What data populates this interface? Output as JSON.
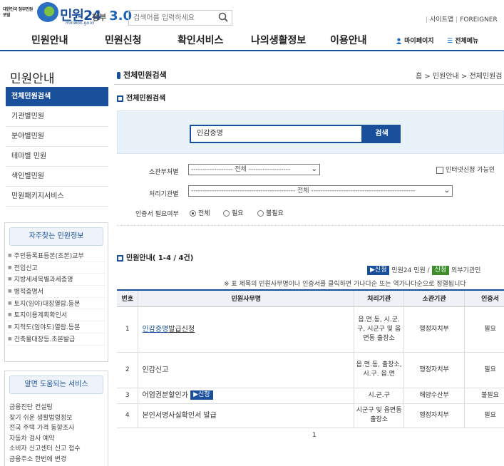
{
  "header": {
    "gov_logo_text": "대한민국 정부민원포털",
    "logo_name": "민원24",
    "logo_url": "minwon.go.kr",
    "gov30_prefix": "정부",
    "gov30_num": "3.0",
    "search_placeholder": "검색어를 입력하세요",
    "sitemap": "사이트맵",
    "foreigner": "FOREIGNER"
  },
  "gnb": {
    "items": [
      "민원안내",
      "민원신청",
      "확인서비스",
      "나의생활정보",
      "이용안내"
    ],
    "mypage": "마이페이지",
    "allmenu": "전체메뉴"
  },
  "sidebar": {
    "title": "민원안내",
    "items": [
      "전체민원검색",
      "기관별민원",
      "분야별민원",
      "테마별 민원",
      "색인별민원",
      "민원패키지서비스"
    ],
    "faq_title": "자주찾는 민원정보",
    "faq_items": [
      "주민등록표등본(초본)교부",
      "전입신고",
      "지방세세목별과세증명",
      "병적증명서",
      "토지(임야)대장열람.등본",
      "토지이용계획확인서",
      "지적도(임야도)열람.등본",
      "건축물대장등.초본발급"
    ],
    "help_title": "알면 도움되는 서비스",
    "help_items": [
      "금융진단 컨설팅",
      "찾기 쉬운 생활법령정보",
      "전국 주택 가격 동향조사",
      "자동차 검사 예약",
      "소비자 신고센터 신고 접수",
      "금융주소 한번에 변경"
    ]
  },
  "main": {
    "page_title": "전체민원검색",
    "breadcrumb": "홈 > 민원안내 > 전체민원검",
    "sub_title": "전체민원검색",
    "search_value": "인감증명",
    "search_button": "검색",
    "dept_label": "소관부처별",
    "dept_value": "------------------ 전체 ------------------",
    "org_label": "처리기관별",
    "org_value": "--------------------------------------------- 전체 ---------------------------------------------",
    "internet_only": "인터넷신청 가능민",
    "cert_label": "인증서 필요여부",
    "cert_options": [
      "전체",
      "필요",
      "불필요"
    ],
    "list_title": "민원안내( 1-4 / 4건)",
    "legend_tag1": "▶신청",
    "legend_text1": "민원24 민원 /",
    "legend_tag2": "신청",
    "legend_text2": "외부기관민",
    "notice": "※ 표 제목의 민원사무명이나 인증서를 클릭하면 가나다순 또는 역가나다순으로 정렬됩니다",
    "table": {
      "headers": [
        "번호",
        "민원사무명",
        "처리기관",
        "소관기관",
        "인증서"
      ],
      "rows": [
        {
          "no": "1",
          "name_link": "인감증명",
          "name_rest": "발급신청",
          "tag": "",
          "org": "읍.면.동, 시.군.구, 시군구 및 읍면동 출장소",
          "dept": "행정자치부",
          "cert": "필요"
        },
        {
          "no": "2",
          "name_link": "",
          "name_rest": "인감신고",
          "tag": "",
          "org": "읍.면.동, 출장소, 시.구. 읍.면",
          "dept": "행정자치부",
          "cert": "필요"
        },
        {
          "no": "3",
          "name_link": "",
          "name_rest": "어업권분할인가",
          "tag": "▶신청",
          "org": "시.군.구",
          "dept": "해양수산부",
          "cert": "불필요"
        },
        {
          "no": "4",
          "name_link": "",
          "name_rest": "본인서명사실확인서 발급",
          "tag": "",
          "org": "시군구 및 읍면동 출장소",
          "dept": "행정자치부",
          "cert": "필요"
        }
      ]
    },
    "page_number": "1"
  }
}
